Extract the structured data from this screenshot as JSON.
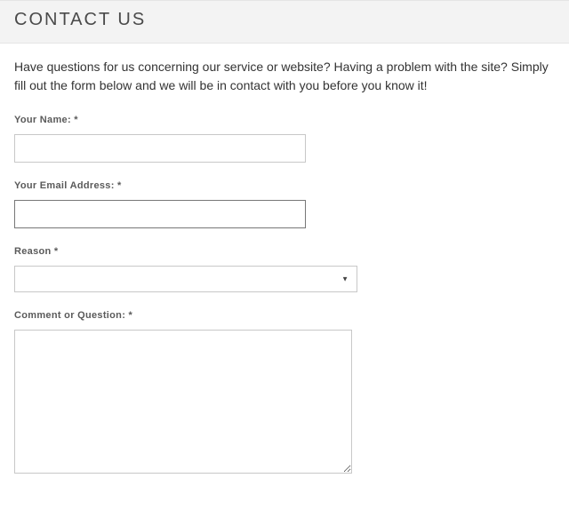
{
  "header": {
    "title": "CONTACT US"
  },
  "intro": "Have questions for us concerning our service or website? Having a problem with the site? Simply fill out the form below and we will be in contact with you before you know it!",
  "form": {
    "name": {
      "label": "Your Name: *",
      "value": ""
    },
    "email": {
      "label": "Your Email Address: *",
      "value": ""
    },
    "reason": {
      "label": "Reason *",
      "value": ""
    },
    "comment": {
      "label": "Comment or Question: *",
      "value": ""
    }
  }
}
